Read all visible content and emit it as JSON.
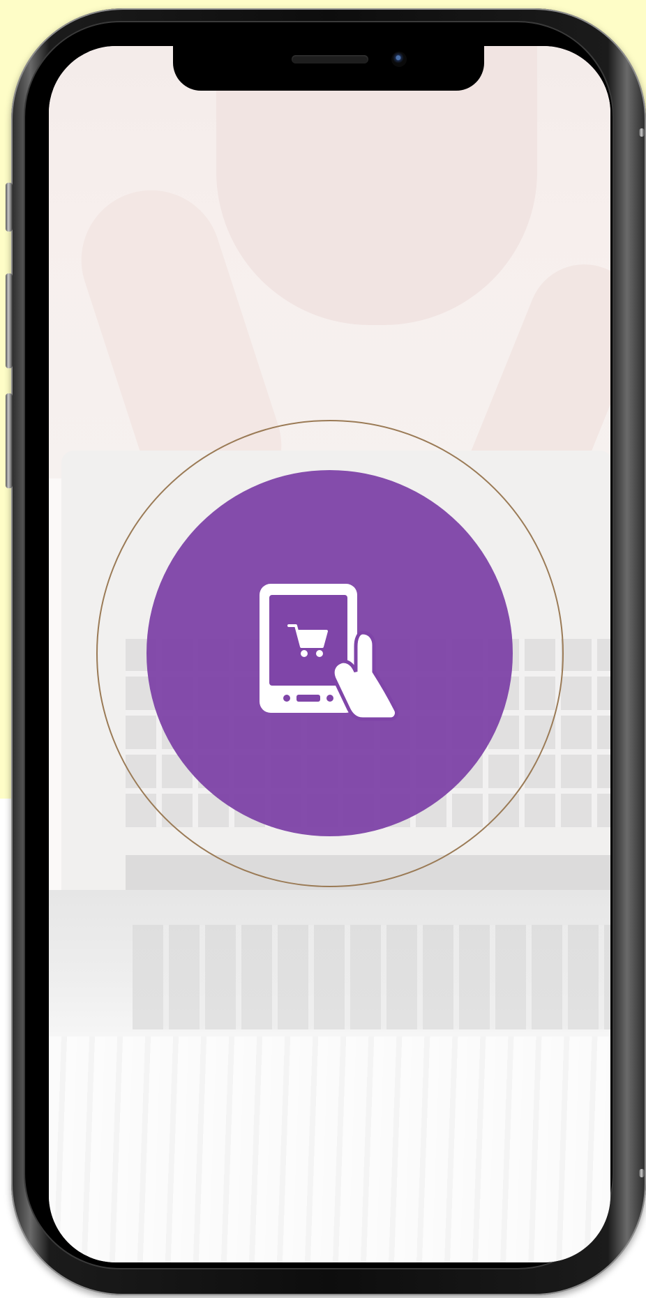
{
  "app": {
    "name": "",
    "icon": "tablet-shopping-cart-hand-icon"
  },
  "colors": {
    "background_accent": "#fefdc7",
    "brand_purple": "#7f45a8",
    "ring": "#9a7a55",
    "icon_fill": "#ffffff"
  }
}
